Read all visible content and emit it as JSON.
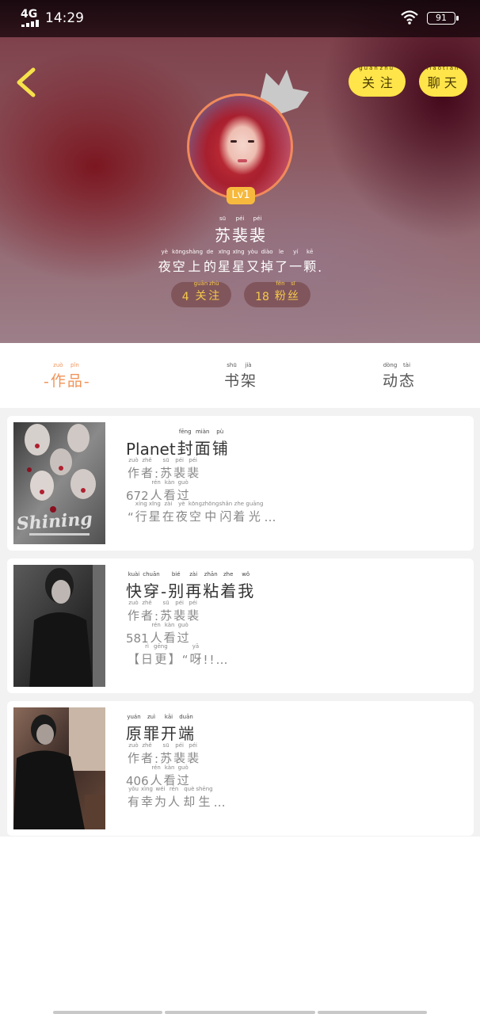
{
  "status_bar": {
    "network": "4G",
    "time": "14:29",
    "battery": "91"
  },
  "profile": {
    "follow_button": [
      [
        "关",
        "guān"
      ],
      [
        "注",
        "zhù"
      ]
    ],
    "chat_button": [
      [
        "聊",
        "liáo"
      ],
      [
        "天",
        "tiān"
      ]
    ],
    "level": "Lv1",
    "name": [
      [
        "苏",
        "sū"
      ],
      [
        "裴",
        "péi"
      ],
      [
        "裴",
        "péi"
      ]
    ],
    "signature": [
      [
        "夜",
        "yè"
      ],
      [
        "空",
        "kōng"
      ],
      [
        "上",
        "shàng"
      ],
      [
        "的",
        "de"
      ],
      [
        "星",
        "xīng"
      ],
      [
        "星",
        "xīng"
      ],
      [
        "又",
        "yòu"
      ],
      [
        "掉",
        "diào"
      ],
      [
        "了",
        "le"
      ],
      [
        "一",
        "yí"
      ],
      [
        "颗",
        "kē"
      ],
      [
        ".",
        ""
      ]
    ],
    "following": {
      "count": "4",
      "label": [
        [
          "关",
          "guān"
        ],
        [
          "注",
          "zhù"
        ]
      ]
    },
    "fans": {
      "count": "18",
      "label": [
        [
          "粉",
          "fěn"
        ],
        [
          "丝",
          "sī"
        ]
      ]
    }
  },
  "tabs": [
    {
      "text": [
        [
          "-",
          ""
        ],
        [
          "作",
          "zuò"
        ],
        [
          "品",
          "pǐn"
        ],
        [
          "-",
          ""
        ]
      ],
      "active": true
    },
    {
      "text": [
        [
          "书",
          "shū"
        ],
        [
          "架",
          "jià"
        ]
      ],
      "active": false
    },
    {
      "text": [
        [
          "动",
          "dòng"
        ],
        [
          "态",
          "tài"
        ]
      ],
      "active": false
    }
  ],
  "works": [
    {
      "title": [
        [
          "Planet",
          ""
        ],
        [
          "封",
          "fēng"
        ],
        [
          "面",
          "miàn"
        ],
        [
          "铺",
          "pù"
        ]
      ],
      "author": [
        [
          "作",
          "zuò"
        ],
        [
          "者",
          "zhě"
        ],
        [
          ":",
          ""
        ],
        [
          "苏",
          "sū"
        ],
        [
          "裴",
          "péi"
        ],
        [
          "裴",
          "péi"
        ]
      ],
      "views": [
        [
          "672",
          ""
        ],
        [
          "人",
          "rén"
        ],
        [
          "看",
          "kàn"
        ],
        [
          "过",
          "guò"
        ]
      ],
      "desc": [
        [
          "“",
          ""
        ],
        [
          "行",
          "xíng"
        ],
        [
          "星",
          "xīng"
        ],
        [
          "在",
          "zài"
        ],
        [
          "夜",
          "yè"
        ],
        [
          "空",
          "kōng"
        ],
        [
          "中",
          "zhōng"
        ],
        [
          "闪",
          "shǎn"
        ],
        [
          "着",
          "zhe"
        ],
        [
          "光",
          "guāng"
        ],
        [
          "…",
          ""
        ]
      ],
      "cover_text": "Shining"
    },
    {
      "title": [
        [
          "快",
          "kuài"
        ],
        [
          "穿",
          "chuān"
        ],
        [
          "-",
          ""
        ],
        [
          "别",
          "bié"
        ],
        [
          "再",
          "zài"
        ],
        [
          "粘",
          "zhān"
        ],
        [
          "着",
          "zhe"
        ],
        [
          "我",
          "wǒ"
        ]
      ],
      "author": [
        [
          "作",
          "zuò"
        ],
        [
          "者",
          "zhě"
        ],
        [
          ":",
          ""
        ],
        [
          "苏",
          "sū"
        ],
        [
          "裴",
          "péi"
        ],
        [
          "裴",
          "péi"
        ]
      ],
      "views": [
        [
          "581",
          ""
        ],
        [
          "人",
          "rén"
        ],
        [
          "看",
          "kàn"
        ],
        [
          "过",
          "guò"
        ]
      ],
      "desc": [
        [
          "【",
          ""
        ],
        [
          "日",
          "rì"
        ],
        [
          "更",
          "gēng"
        ],
        [
          "】",
          ""
        ],
        [
          "“",
          ""
        ],
        [
          "呀",
          "yā"
        ],
        [
          "!",
          ""
        ],
        [
          "!",
          ""
        ],
        [
          "…",
          ""
        ]
      ],
      "cover_text": ""
    },
    {
      "title": [
        [
          "原",
          "yuán"
        ],
        [
          "罪",
          "zuì"
        ],
        [
          "开",
          "kāi"
        ],
        [
          "端",
          "duān"
        ]
      ],
      "author": [
        [
          "作",
          "zuò"
        ],
        [
          "者",
          "zhě"
        ],
        [
          ":",
          ""
        ],
        [
          "苏",
          "sū"
        ],
        [
          "裴",
          "péi"
        ],
        [
          "裴",
          "péi"
        ]
      ],
      "views": [
        [
          "406",
          ""
        ],
        [
          "人",
          "rén"
        ],
        [
          "看",
          "kàn"
        ],
        [
          "过",
          "guò"
        ]
      ],
      "desc": [
        [
          "有",
          "yǒu"
        ],
        [
          "幸",
          "xìng"
        ],
        [
          "为",
          "wéi"
        ],
        [
          "人",
          "rén"
        ],
        [
          " ",
          ""
        ],
        [
          "却",
          "què"
        ],
        [
          "生",
          "shēng"
        ],
        [
          "…",
          ""
        ]
      ],
      "cover_text": ""
    }
  ],
  "colors": {
    "accent_yellow": "#ffe44a",
    "active_tab": "#f0945a",
    "stat_text": "#f6c94a"
  }
}
